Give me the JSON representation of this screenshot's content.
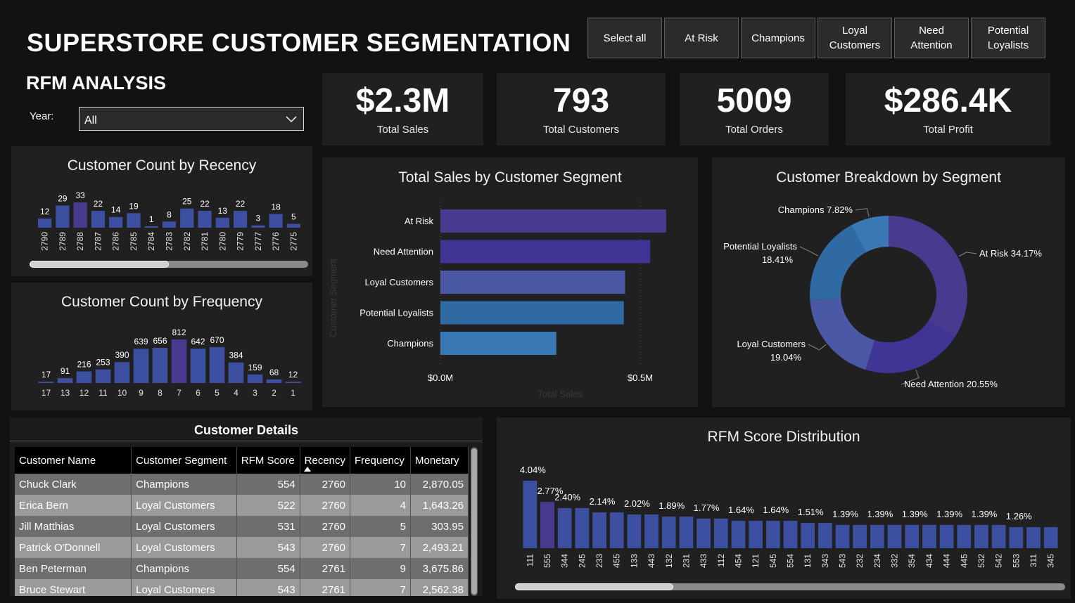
{
  "header": {
    "title": "SUPERSTORE CUSTOMER SEGMENTATION",
    "subtitle": "RFM ANALYSIS",
    "year_label": "Year:",
    "year_value": "All"
  },
  "segment_slicers": [
    "Select all",
    "At Risk",
    "Champions",
    "Loyal Customers",
    "Need Attention",
    "Potential Loyalists"
  ],
  "kpis": [
    {
      "value": "$2.3M",
      "label": "Total Sales"
    },
    {
      "value": "793",
      "label": "Total Customers"
    },
    {
      "value": "5009",
      "label": "Total Orders"
    },
    {
      "value": "$286.4K",
      "label": "Total Profit"
    }
  ],
  "colors": {
    "background": "#121212",
    "panel": "#202020",
    "bar_blue": "#3d4fa0",
    "bar_purple": "#4a3a8f",
    "at_risk": "#4a3a8f",
    "need_attention": "#3f3594",
    "loyal": "#4b58a6",
    "potential": "#2f6aa3",
    "champions": "#3a78b5"
  },
  "chart_data": [
    {
      "type": "bar",
      "title": "Customer Count by Recency",
      "categories": [
        "2790",
        "2789",
        "2788",
        "2787",
        "2786",
        "2785",
        "2784",
        "2783",
        "2782",
        "2781",
        "2780",
        "2779",
        "2777",
        "2776",
        "2775"
      ],
      "values": [
        12,
        29,
        33,
        22,
        14,
        19,
        1,
        8,
        25,
        22,
        13,
        22,
        3,
        18,
        5
      ],
      "highlight_index": 2
    },
    {
      "type": "bar",
      "title": "Customer Count by Frequency",
      "categories": [
        "17",
        "13",
        "12",
        "11",
        "10",
        "9",
        "8",
        "7",
        "6",
        "5",
        "4",
        "3",
        "2",
        "1"
      ],
      "values": [
        17,
        91,
        216,
        253,
        390,
        639,
        656,
        812,
        642,
        670,
        384,
        159,
        68,
        12
      ],
      "highlight_index": 7
    },
    {
      "type": "bar",
      "orientation": "horizontal",
      "title": "Total Sales by Customer Segment",
      "xlabel": "Total Sales",
      "ylabel": "Customer Segment",
      "categories": [
        "At Risk",
        "Need Attention",
        "Loyal Customers",
        "Potential Loyalists",
        "Champions"
      ],
      "values": [
        0.565,
        0.525,
        0.462,
        0.459,
        0.29
      ],
      "xticks": [
        "$0.0M",
        "$0.5M"
      ],
      "xlim": [
        0,
        0.5
      ]
    },
    {
      "type": "pie",
      "donut": true,
      "title": "Customer Breakdown by Segment",
      "categories": [
        "At Risk",
        "Need Attention",
        "Loyal Customers",
        "Potential Loyalists",
        "Champions"
      ],
      "values": [
        34.17,
        20.55,
        19.04,
        18.41,
        7.82
      ],
      "labels": [
        "At Risk 34.17%",
        "Need Attention 20.55%",
        "Loyal Customers 19.04%",
        "Potential Loyalists 18.41%",
        "Champions 7.82%"
      ]
    },
    {
      "type": "bar",
      "title": "RFM Score Distribution",
      "categories": [
        "111",
        "555",
        "344",
        "245",
        "233",
        "455",
        "133",
        "443",
        "132",
        "231",
        "433",
        "112",
        "454",
        "121",
        "545",
        "554",
        "131",
        "343",
        "543",
        "232",
        "234",
        "332",
        "354",
        "434",
        "444",
        "445",
        "532",
        "542",
        "553",
        "311",
        "345"
      ],
      "values": [
        4.04,
        2.77,
        2.4,
        2.4,
        2.14,
        2.14,
        2.02,
        2.02,
        1.89,
        1.89,
        1.77,
        1.77,
        1.64,
        1.64,
        1.64,
        1.64,
        1.51,
        1.51,
        1.39,
        1.39,
        1.39,
        1.39,
        1.39,
        1.39,
        1.39,
        1.39,
        1.39,
        1.39,
        1.26,
        1.26,
        1.26
      ],
      "labels": [
        "4.04%",
        "2.77%",
        "2.40%",
        "2.14%",
        "2.02%",
        "1.89%",
        "1.77%",
        "1.64%",
        "1.64%",
        "1.51%",
        "1.39%",
        "1.39%",
        "1.39%",
        "1.39%",
        "1.39%",
        "1.26%"
      ],
      "highlight_index": 1
    }
  ],
  "details": {
    "title": "Customer Details",
    "columns": [
      "Customer Name",
      "Customer Segment",
      "RFM Score",
      "Recency",
      "Frequency",
      "Monetary"
    ],
    "rows": [
      [
        "Chuck Clark",
        "Champions",
        "554",
        "2760",
        "10",
        "2,870.05"
      ],
      [
        "Erica Bern",
        "Loyal Customers",
        "522",
        "2760",
        "4",
        "1,643.26"
      ],
      [
        "Jill Matthias",
        "Loyal Customers",
        "531",
        "2760",
        "5",
        "303.95"
      ],
      [
        "Patrick O'Donnell",
        "Loyal Customers",
        "543",
        "2760",
        "7",
        "2,493.21"
      ],
      [
        "Ben Peterman",
        "Champions",
        "554",
        "2761",
        "9",
        "3,675.86"
      ],
      [
        "Bruce Stewart",
        "Loyal Customers",
        "543",
        "2761",
        "7",
        "2,562.38"
      ]
    ]
  }
}
